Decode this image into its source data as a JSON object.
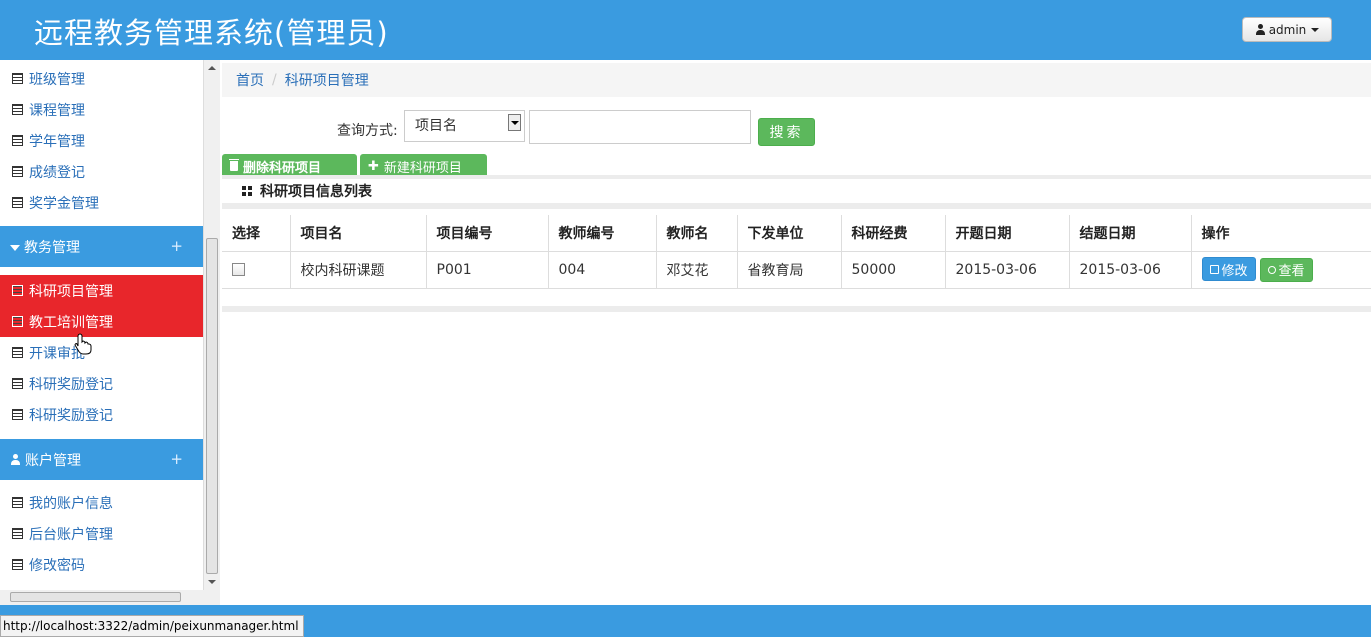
{
  "header": {
    "title": "远程教务管理系统(管理员)",
    "user_button": "admin"
  },
  "sidebar": {
    "top_items": [
      "班级管理",
      "课程管理",
      "学年管理",
      "成绩登记",
      "奖学金管理"
    ],
    "group_academic": "教务管理",
    "academic_items": [
      "科研项目管理",
      "教工培训管理",
      "开课审批",
      "科研奖励登记",
      "科研奖励登记"
    ],
    "group_account": "账户管理",
    "account_items": [
      "我的账户信息",
      " 后台账户管理",
      "修改密码"
    ],
    "group_plus": "+"
  },
  "breadcrumb": {
    "home": "首页",
    "separator": "/",
    "current": "科研项目管理"
  },
  "search": {
    "label": "查询方式:",
    "select_value": "项目名",
    "input_value": "",
    "button": "搜索"
  },
  "actions": {
    "delete": "删除科研项目",
    "create": "新建科研项目"
  },
  "panel": {
    "title": "科研项目信息列表"
  },
  "table": {
    "headers": [
      "选择",
      "项目名",
      "项目编号",
      "教师编号",
      "教师名",
      "下发单位",
      "科研经费",
      "开题日期",
      "结题日期",
      "操作"
    ],
    "rows": [
      {
        "name": "校内科研课题",
        "code": "P001",
        "teacher_id": "004",
        "teacher_name": "邓艾花",
        "unit": "省教育局",
        "funding": "50000",
        "start_date": "2015-03-06",
        "end_date": "2015-03-06",
        "edit": "修改",
        "view": "查看"
      }
    ]
  },
  "status_bar": {
    "url": "http://localhost:3322/admin/peixunmanager.html"
  },
  "colors": {
    "primary": "#3a9be0",
    "active": "#e8262b",
    "success": "#5cb85c"
  }
}
